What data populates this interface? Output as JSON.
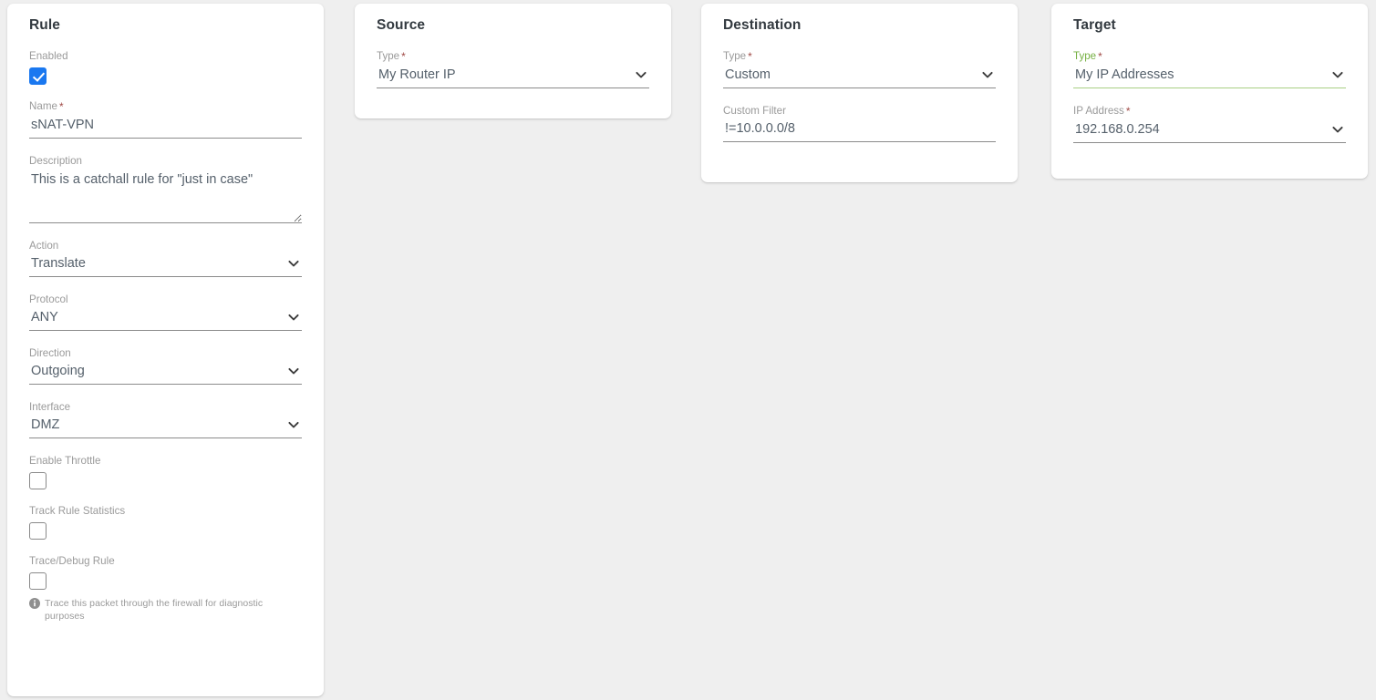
{
  "colors": {
    "page_background": "#efefef",
    "card_background": "#ffffff",
    "label_gray": "#9a9a9a",
    "value_text": "#55606b",
    "title_text": "#333a40",
    "required_asterisk": "#a14a46",
    "checkbox_checked_blue": "#1a78f0",
    "valid_green_label": "#76b043",
    "valid_green_underline": "#a8cf84",
    "input_underline": "#8b8b8b"
  },
  "required_marker": "*",
  "rule": {
    "title": "Rule",
    "enabled": {
      "label": "Enabled",
      "checked": true,
      "icon": "checkmark-icon"
    },
    "name": {
      "label": "Name",
      "required": true,
      "value": "sNAT-VPN",
      "placeholder": ""
    },
    "description": {
      "label": "Description",
      "required": false,
      "value": "This is a catchall rule for \"just in case\"",
      "placeholder": ""
    },
    "action": {
      "label": "Action",
      "required": false,
      "value": "Translate",
      "icon": "chevron-down-icon"
    },
    "protocol": {
      "label": "Protocol",
      "required": false,
      "value": "ANY",
      "icon": "chevron-down-icon"
    },
    "direction": {
      "label": "Direction",
      "required": false,
      "value": "Outgoing",
      "icon": "chevron-down-icon"
    },
    "interface": {
      "label": "Interface",
      "required": false,
      "value": "DMZ",
      "icon": "chevron-down-icon"
    },
    "enable_throttle": {
      "label": "Enable Throttle",
      "checked": false
    },
    "track_rule_statistics": {
      "label": "Track Rule Statistics",
      "checked": false
    },
    "trace_debug_rule": {
      "label": "Trace/Debug Rule",
      "checked": false,
      "hint": "Trace this packet through the firewall for diagnostic purposes",
      "hint_icon": "info-icon"
    }
  },
  "source": {
    "title": "Source",
    "type": {
      "label": "Type",
      "required": true,
      "value": "My Router IP",
      "icon": "chevron-down-icon"
    }
  },
  "destination": {
    "title": "Destination",
    "type": {
      "label": "Type",
      "required": true,
      "value": "Custom",
      "icon": "chevron-down-icon"
    },
    "custom_filter": {
      "label": "Custom Filter",
      "required": false,
      "value": "!=10.0.0.0/8",
      "placeholder": ""
    }
  },
  "target": {
    "title": "Target",
    "type": {
      "label": "Type",
      "required": true,
      "value": "My IP Addresses",
      "valid": true,
      "icon": "chevron-down-icon"
    },
    "ip_address": {
      "label": "IP Address",
      "required": true,
      "value": "192.168.0.254",
      "icon": "chevron-down-icon"
    }
  }
}
